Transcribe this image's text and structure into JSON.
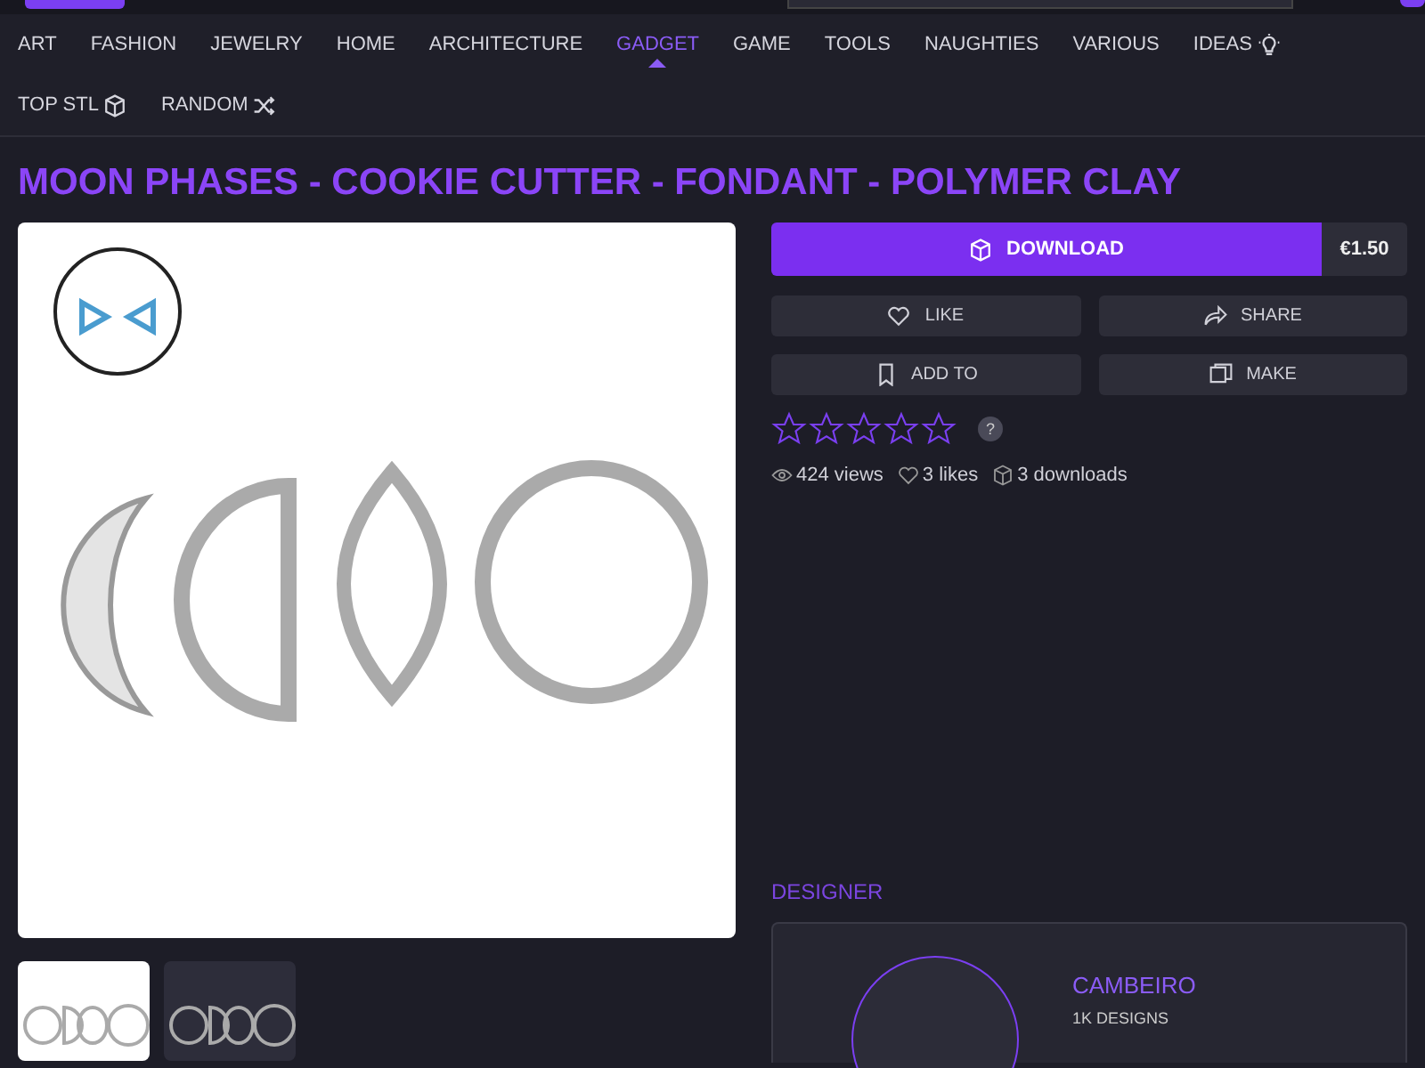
{
  "nav": [
    {
      "label": "ART",
      "selected": false,
      "kind": "plain"
    },
    {
      "label": "FASHION",
      "selected": false,
      "kind": "plain"
    },
    {
      "label": "JEWELRY",
      "selected": false,
      "kind": "plain"
    },
    {
      "label": "HOME",
      "selected": false,
      "kind": "plain"
    },
    {
      "label": "ARCHITECTURE",
      "selected": false,
      "kind": "plain"
    },
    {
      "label": "GADGET",
      "selected": true,
      "kind": "plain"
    },
    {
      "label": "GAME",
      "selected": false,
      "kind": "plain"
    },
    {
      "label": "TOOLS",
      "selected": false,
      "kind": "plain"
    },
    {
      "label": "NAUGHTIES",
      "selected": false,
      "kind": "plain"
    },
    {
      "label": "VARIOUS",
      "selected": false,
      "kind": "plain"
    },
    {
      "label": "IDEAS",
      "selected": false,
      "kind": "ideas"
    },
    {
      "label": "TOP STL",
      "selected": false,
      "kind": "top"
    },
    {
      "label": "RANDOM",
      "selected": false,
      "kind": "random"
    }
  ],
  "title": "MOON PHASES - COOKIE CUTTER - FONDANT - POLYMER CLAY",
  "thumbnails": [
    {
      "selected": true
    },
    {
      "selected": false
    }
  ],
  "download": {
    "label": "DOWNLOAD",
    "price": "€1.50"
  },
  "actions": [
    {
      "label": "LIKE",
      "kind": "like"
    },
    {
      "label": "SHARE",
      "kind": "share"
    },
    {
      "label": "ADD TO",
      "kind": "add"
    },
    {
      "label": "MAKE",
      "kind": "make"
    }
  ],
  "rating": {
    "stars": 0,
    "help": "?"
  },
  "stats": [
    {
      "text": "424 views",
      "kind": "views"
    },
    {
      "text": "3 likes",
      "kind": "likes"
    },
    {
      "text": "3 downloads",
      "kind": "downloads"
    }
  ],
  "designer": {
    "heading": "DESIGNER",
    "name": "CAMBEIRO",
    "designs": "1K DESIGNS"
  }
}
